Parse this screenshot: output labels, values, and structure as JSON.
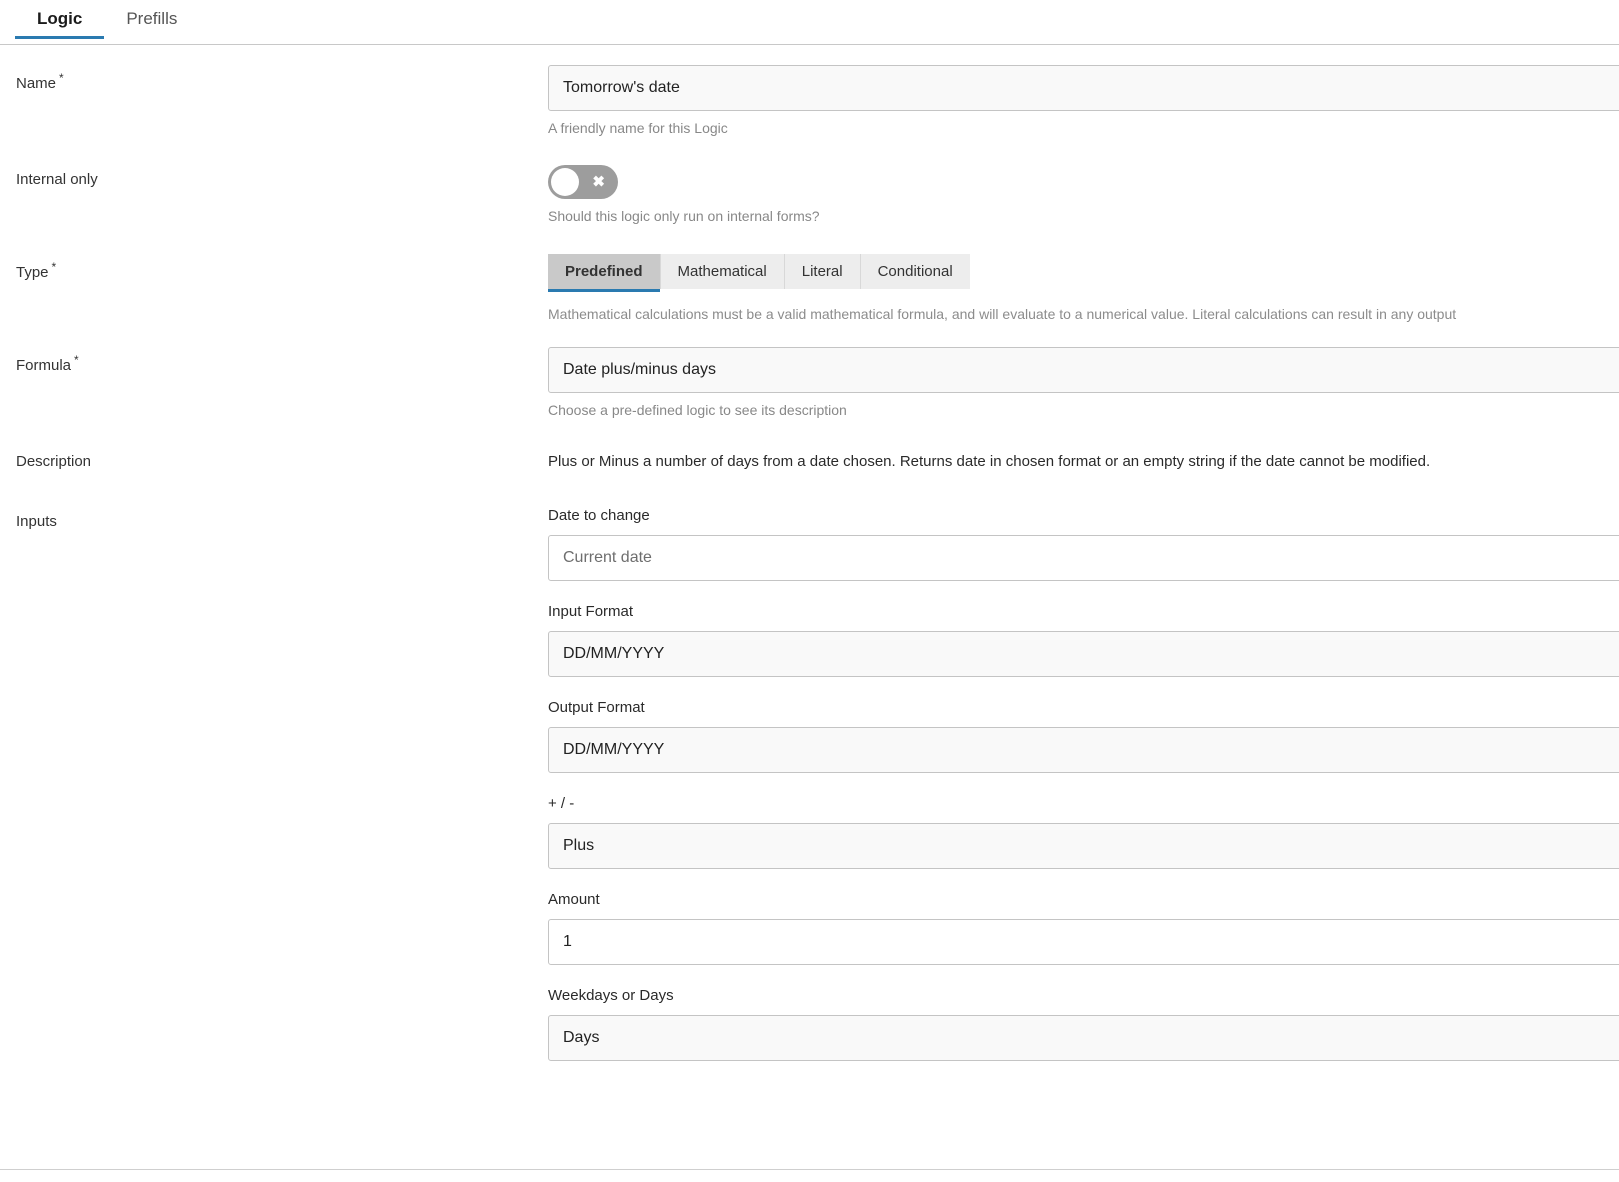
{
  "tabs": [
    {
      "label": "Logic",
      "active": true
    },
    {
      "label": "Prefills",
      "active": false
    }
  ],
  "accent_color": "#2a7ab0",
  "form": {
    "name": {
      "label": "Name",
      "required": "*",
      "value": "Tomorrow's date",
      "helper": "A friendly name for this Logic"
    },
    "internal_only": {
      "label": "Internal only",
      "state": "off",
      "toggle_mark": "✖",
      "helper": "Should this logic only run on internal forms?"
    },
    "type": {
      "label": "Type",
      "required": "*",
      "options": [
        "Predefined",
        "Mathematical",
        "Literal",
        "Conditional"
      ],
      "selected": "Predefined",
      "helper": "Mathematical calculations must be a valid mathematical formula, and will evaluate to a numerical value. Literal calculations can result in any output"
    },
    "formula": {
      "label": "Formula",
      "required": "*",
      "value": "Date plus/minus days",
      "helper": "Choose a pre-defined logic to see its description"
    },
    "description": {
      "label": "Description",
      "text": "Plus or Minus a number of days from a date chosen. Returns date in chosen format or an empty string if the date cannot be modified."
    },
    "inputs": {
      "label": "Inputs",
      "fields": [
        {
          "label": "Date to change",
          "value": "Current date",
          "style": "placeholder"
        },
        {
          "label": "Input Format",
          "value": "DD/MM/YYYY",
          "style": "filled"
        },
        {
          "label": "Output Format",
          "value": "DD/MM/YYYY",
          "style": "filled"
        },
        {
          "label": "+ / -",
          "value": "Plus",
          "style": "filled"
        },
        {
          "label": "Amount",
          "value": "1",
          "style": "white"
        },
        {
          "label": "Weekdays or Days",
          "value": "Days",
          "style": "filled"
        }
      ]
    }
  }
}
